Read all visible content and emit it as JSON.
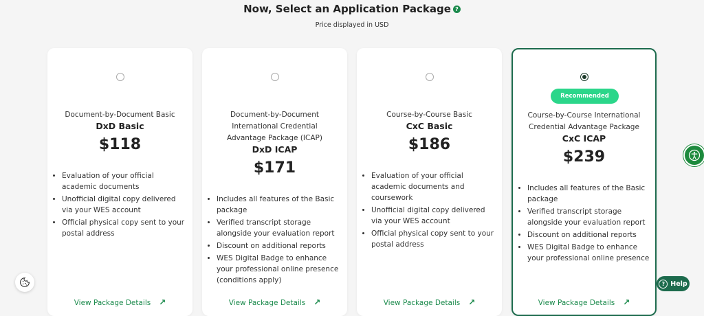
{
  "header": {
    "title": "Now, Select an Application Package",
    "help_icon": "?",
    "subtitle": "Price displayed in USD"
  },
  "packages": [
    {
      "subtitle": "Document-by-Document Basic",
      "title": "DxD Basic",
      "price": "$118",
      "selected": false,
      "features": [
        "Evaluation of your official academic documents",
        "Unofficial digital copy delivered via your WES account",
        "Official physical copy sent to your postal address"
      ],
      "link": "View Package Details"
    },
    {
      "subtitle": "Document-by-Document International Credential Advantage Package (ICAP)",
      "title": "DxD ICAP",
      "price": "$171",
      "selected": false,
      "features": [
        "Includes all features of the Basic package",
        "Verified transcript storage alongside your evaluation report",
        "Discount on additional reports",
        "WES Digital Badge to enhance your professional online presence (conditions apply)"
      ],
      "link": "View Package Details"
    },
    {
      "subtitle": "Course-by-Course Basic",
      "title": "CxC Basic",
      "price": "$186",
      "selected": false,
      "features": [
        "Evaluation of your official academic documents and coursework",
        "Unofficial digital copy delivered via your WES account",
        "Official physical copy sent to your postal address"
      ],
      "link": "View Package Details"
    },
    {
      "badge": "Recommended",
      "subtitle": "Course-by-Course International Credential Advantage Package",
      "title": "CxC ICAP",
      "price": "$239",
      "selected": true,
      "features": [
        "Includes all features of the Basic package",
        "Verified transcript storage alongside your evaluation report",
        "Discount on additional reports",
        "WES Digital Badge to enhance your professional online presence"
      ],
      "link": "View Package Details"
    }
  ],
  "widgets": {
    "help_label": "Help",
    "help_icon": "?"
  },
  "colors": {
    "accent": "#1b8a4c",
    "badge": "#2bd68a",
    "selected_border": "#1d6b4d"
  }
}
